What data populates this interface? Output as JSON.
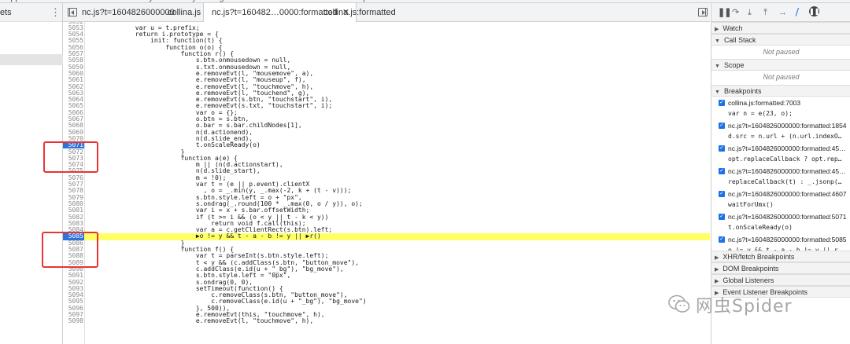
{
  "top_menu": [
    "Application",
    "Performance",
    "Memory",
    "Security",
    "Lighthouse",
    "EditThisCookie",
    "Web Scraper"
  ],
  "navigator": {
    "label": "ets",
    "more": "⋮"
  },
  "tabs": [
    {
      "label": "nc.js?t=1604826000000",
      "active": false,
      "closable": false
    },
    {
      "label": "collina.js",
      "active": false,
      "closable": false
    },
    {
      "label": "nc.js?t=160482…0000:formatted",
      "active": true,
      "closable": true
    },
    {
      "label": "collina.js:formatted",
      "active": false,
      "closable": false
    }
  ],
  "code_lines": [
    {
      "n": "5052",
      "t": ""
    },
    {
      "n": "5053",
      "t": "            var u = t.prefix;"
    },
    {
      "n": "5054",
      "t": "            return i.prototype = {"
    },
    {
      "n": "5055",
      "t": "                init: function(t) {"
    },
    {
      "n": "5056",
      "t": "                    function o(o) {"
    },
    {
      "n": "5057",
      "t": "                        function r() {"
    },
    {
      "n": "5058",
      "t": "                            s.btn.onmousedown = null,"
    },
    {
      "n": "5059",
      "t": "                            s.txt.onmousedown = null,"
    },
    {
      "n": "5060",
      "t": "                            e.removeEvt(l, \"mousemove\", a),"
    },
    {
      "n": "5061",
      "t": "                            e.removeEvt(l, \"mouseup\", f),"
    },
    {
      "n": "5062",
      "t": "                            e.removeEvt(l, \"touchmove\", h),"
    },
    {
      "n": "5063",
      "t": "                            e.removeEvt(l, \"touchend\", g),"
    },
    {
      "n": "5064",
      "t": "                            e.removeEvt(s.btn, \"touchstart\", i),"
    },
    {
      "n": "5065",
      "t": "                            e.removeEvt(s.txt, \"touchstart\", i);"
    },
    {
      "n": "5066",
      "t": "                            var o = {};"
    },
    {
      "n": "5067",
      "t": "                            o.btn = s.btn,"
    },
    {
      "n": "5068",
      "t": "                            o.bar = s.bar.childNodes[1],"
    },
    {
      "n": "5069",
      "t": "                            n(d.actionend),"
    },
    {
      "n": "5070",
      "t": "                            n(d.slide_end),"
    },
    {
      "n": "5071",
      "t": "                            t.onScaleReady(o)",
      "bp": true
    },
    {
      "n": "5072",
      "t": "                        }"
    },
    {
      "n": "5073",
      "t": "                        function a(e) {"
    },
    {
      "n": "5074",
      "t": "                            m || (n(d.actionstart),"
    },
    {
      "n": "5075",
      "t": "                            n(d.slide_start),"
    },
    {
      "n": "5076",
      "t": "                            m = !0);"
    },
    {
      "n": "5077",
      "t": "                            var t = (e || p.event).clientX"
    },
    {
      "n": "5078",
      "t": "                              , o = _.min(y, _.max(-2, k + (t - v)));"
    },
    {
      "n": "5079",
      "t": "                            s.btn.style.left = o + \"px\","
    },
    {
      "n": "5080",
      "t": "                            s.ondrag(_.round(100 * _.max(0, o / y)), o);"
    },
    {
      "n": "5081",
      "t": "                            var i = x + s.bar.offsetWidth;"
    },
    {
      "n": "5082",
      "t": "                            if (t >= i && (o < y || t - k < y))"
    },
    {
      "n": "5083",
      "t": "                                return void f.call(this);"
    },
    {
      "n": "5084",
      "t": "                            var a = c.getClientRect(s.btn).left;"
    },
    {
      "n": "5085",
      "t": "                            ▶o != y && t - a - b != y || ▶r()",
      "exec": true
    },
    {
      "n": "5086",
      "t": "                        }"
    },
    {
      "n": "5087",
      "t": "                        function f() {"
    },
    {
      "n": "5088",
      "t": "                            var t = parseInt(s.btn.style.left);"
    },
    {
      "n": "5089",
      "t": "                            t < y && (c.addClass(s.btn, \"button_move\"),"
    },
    {
      "n": "5090",
      "t": "                            c.addClass(e.id(u + \"_bg\"), \"bg_move\"),"
    },
    {
      "n": "5091",
      "t": "                            s.btn.style.left = \"0px\","
    },
    {
      "n": "5092",
      "t": "                            s.ondrag(0, 0),"
    },
    {
      "n": "5093",
      "t": "                            setTimeout(function() {"
    },
    {
      "n": "5094",
      "t": "                                c.removeClass(s.btn, \"button_move\"),"
    },
    {
      "n": "5095",
      "t": "                                c.removeClass(e.id(u + \"_bg\"), \"bg_move\")"
    },
    {
      "n": "5096",
      "t": "                            }, 500)),"
    },
    {
      "n": "5097",
      "t": "                            e.removeEvt(this, \"touchmove\", h),"
    },
    {
      "n": "5098",
      "t": "                            e.removeEvt(l, \"touchmove\", h),"
    }
  ],
  "debugger": {
    "toolbar_icons": [
      "pause-icon",
      "step-over-icon",
      "step-into-icon",
      "step-out-icon",
      "step-icon",
      "deactivate-breakpoints-icon",
      "pause-on-exceptions-icon"
    ],
    "sections": {
      "watch": "Watch",
      "call_stack": "Call Stack",
      "scope": "Scope",
      "breakpoints": "Breakpoints",
      "xhr": "XHR/fetch Breakpoints",
      "dom": "DOM Breakpoints",
      "global": "Global Listeners",
      "event": "Event Listener Breakpoints"
    },
    "not_paused": "Not paused",
    "breakpoints": [
      {
        "loc": "collina.js:formatted:7003",
        "snip": "var n = e(23, o);"
      },
      {
        "loc": "nc.js?t=1604826000000:formatted:1854",
        "snip": "d.src = n.url + (n.url.indexO…"
      },
      {
        "loc": "nc.js?t=1604826000000:formatted:45…",
        "snip": "opt.replaceCallback ? opt.rep…"
      },
      {
        "loc": "nc.js?t=1604826000000:formatted:45…",
        "snip": "replaceCallback(t) : _.jsonp(…"
      },
      {
        "loc": "nc.js?t=1604826000000:formatted:4607",
        "snip": "waitForUmx()"
      },
      {
        "loc": "nc.js?t=1604826000000:formatted:5071",
        "snip": "t.onScaleReady(o)"
      },
      {
        "loc": "nc.js?t=1604826000000:formatted:5085",
        "snip": "o != y && t - a - b != y || r…"
      }
    ]
  },
  "watermark": {
    "text": "网虫Spider"
  },
  "colors": {
    "highlight": "#ffff66",
    "breakpoint": "#2f73d8",
    "annotation": "#e83434",
    "checkbox": "#1a73e8"
  }
}
